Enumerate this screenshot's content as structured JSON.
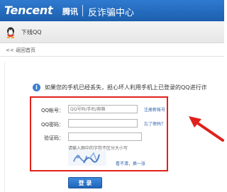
{
  "header": {
    "logo_en": "Tencent",
    "logo_cn": "腾讯",
    "center_title": "反诈骗中心"
  },
  "qq_bar": {
    "label": "下线QQ",
    "icon": "qq-penguin-icon"
  },
  "nav": {
    "back_link": "<< 返回首页"
  },
  "notice": {
    "icon": "info-icon",
    "text": "如果您的手机已经丢失，担心坏人利用手机上已登录的QQ进行诈"
  },
  "form": {
    "qq_label": "QQ帐号：",
    "qq_placeholder": "QQ号码/手机/邮箱",
    "qq_link": "注册新帐号",
    "password_label": "QQ密码：",
    "password_link": "忘了密码？",
    "captcha_label": "验证码：",
    "captcha_hint": "请输入图中的字符不区分大小写",
    "captcha_refresh": "看不清，换一张",
    "login_button": "登 录"
  },
  "colors": {
    "header_blue": "#1d5fae",
    "highlight_red": "#e0211b",
    "link_blue": "#2b5fa8"
  }
}
